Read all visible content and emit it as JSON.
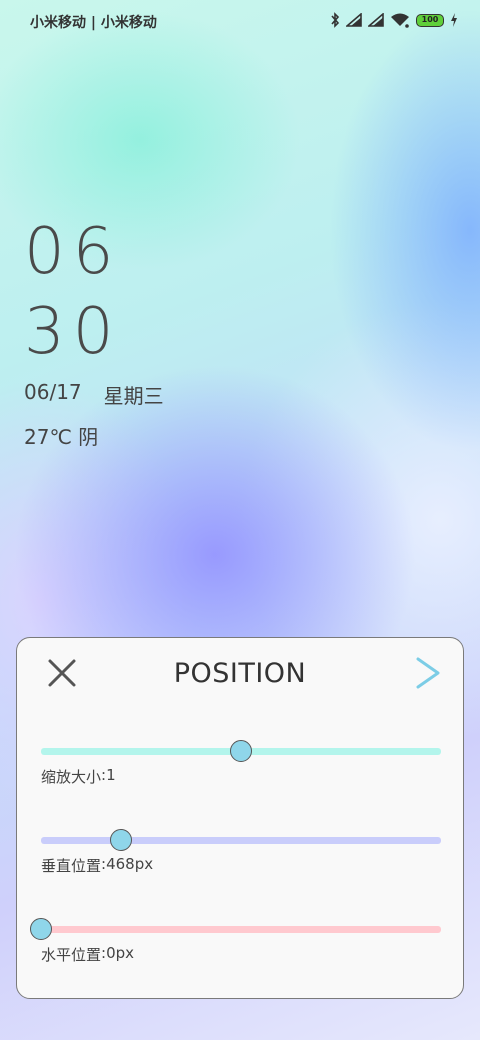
{
  "status_bar": {
    "carrier": "小米移动 | 小米移动",
    "battery_level": "100",
    "icons": [
      "bluetooth-icon",
      "signal-icon",
      "signal-icon",
      "wifi-icon",
      "battery-icon",
      "charging-icon"
    ],
    "battery_color": "#5fcf3a"
  },
  "lockscreen": {
    "hour": "06",
    "minute": "30",
    "date": "06/17",
    "weekday": "星期三",
    "weather": "27℃ 阴"
  },
  "panel": {
    "title": "POSITION",
    "close_icon": "close-icon",
    "next_icon": "chevron-right-icon",
    "next_color": "#7ccde6",
    "sliders": [
      {
        "label": "缩放大小",
        "separator": ": ",
        "value_text": "1",
        "fraction": 0.5,
        "track_color": "#b3f5ec"
      },
      {
        "label": "垂直位置",
        "separator": ": ",
        "value_text": "468px",
        "fraction": 0.2,
        "track_color": "#c9cdfb"
      },
      {
        "label": "水平位置",
        "separator": ": ",
        "value_text": "0px",
        "fraction": 0.0,
        "track_color": "#ffc9cf"
      }
    ],
    "thumb_color": "#8fd6ea"
  }
}
